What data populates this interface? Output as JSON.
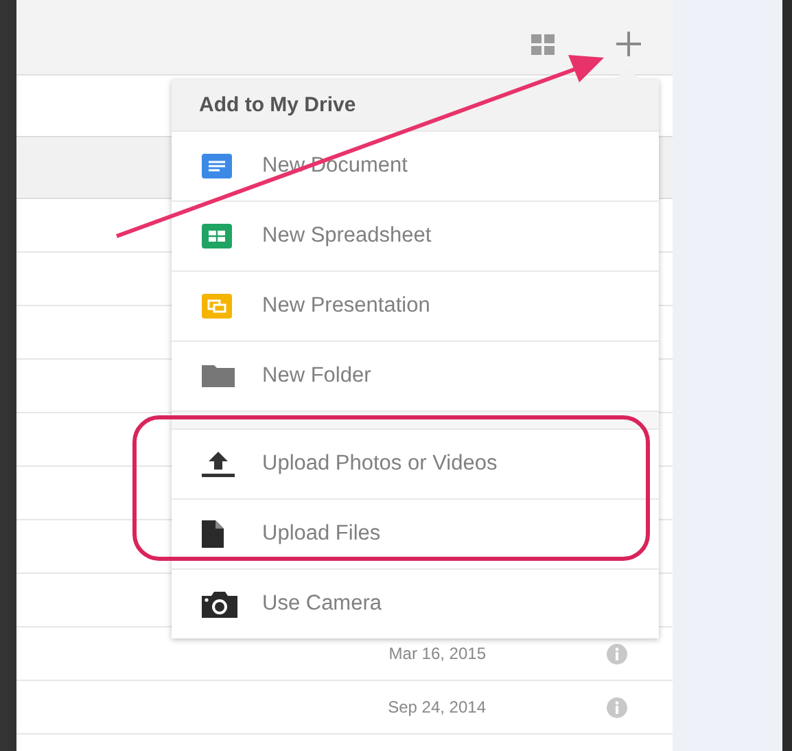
{
  "menu": {
    "title": "Add to My Drive",
    "groups": [
      [
        {
          "kind": "document",
          "label": "New Document"
        },
        {
          "kind": "spreadsheet",
          "label": "New Spreadsheet"
        },
        {
          "kind": "presentation",
          "label": "New Presentation"
        },
        {
          "kind": "folder",
          "label": "New Folder"
        }
      ],
      [
        {
          "kind": "upload",
          "label": "Upload Photos or Videos"
        },
        {
          "kind": "file",
          "label": "Upload Files"
        },
        {
          "kind": "camera",
          "label": "Use Camera"
        }
      ]
    ]
  },
  "file_list": {
    "rows": [
      {
        "date": "Mar 16, 2015"
      },
      {
        "date": "Sep 24, 2014"
      }
    ]
  }
}
